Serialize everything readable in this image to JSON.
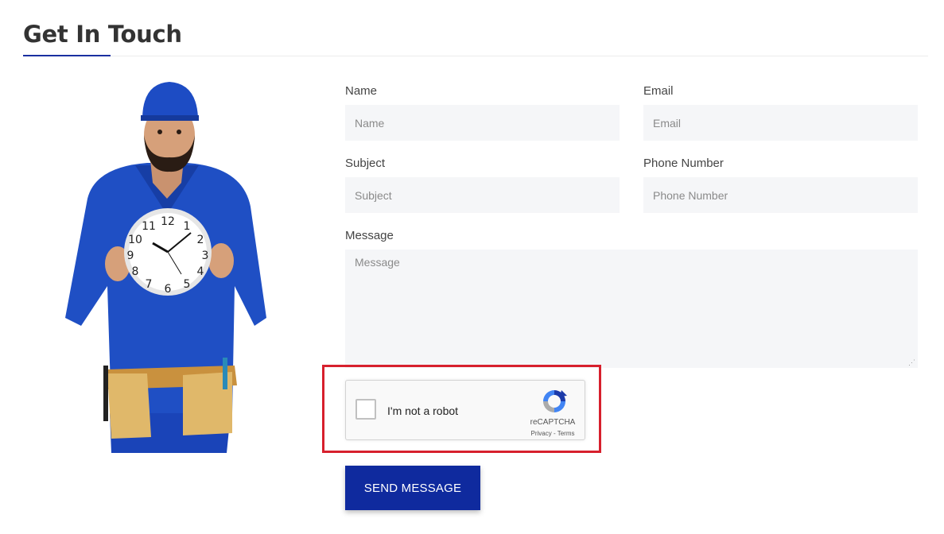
{
  "section": {
    "title": "Get In Touch"
  },
  "form": {
    "name": {
      "label": "Name",
      "placeholder": "Name"
    },
    "email": {
      "label": "Email",
      "placeholder": "Email"
    },
    "subject": {
      "label": "Subject",
      "placeholder": "Subject"
    },
    "phone": {
      "label": "Phone Number",
      "placeholder": "Phone Number"
    },
    "message": {
      "label": "Message",
      "placeholder": "Message"
    },
    "submit_label": "SEND MESSAGE"
  },
  "recaptcha": {
    "checkbox_label": "I'm not a robot",
    "brand": "reCAPTCHA",
    "links": "Privacy - Terms"
  },
  "colors": {
    "accent": "#0f2a9e",
    "highlight": "#d7202d",
    "field_bg": "#f5f6f8"
  }
}
